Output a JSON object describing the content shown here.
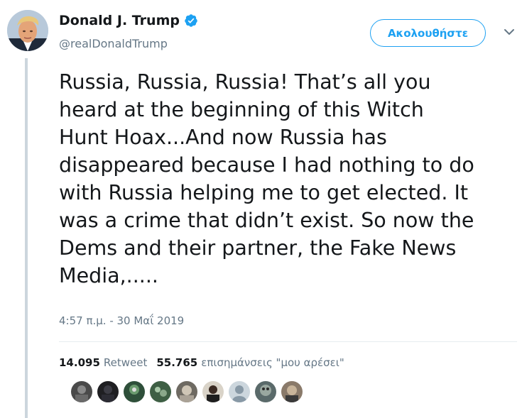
{
  "author": {
    "name": "Donald J. Trump",
    "handle": "@realDonaldTrump"
  },
  "follow_button": {
    "label": "Ακολουθήστε"
  },
  "tweet": {
    "text": "Russia, Russia, Russia! That’s all you\nheard at the beginning of this Witch\nHunt Hoax...And now Russia has\ndisappeared because I had nothing to do\nwith Russia helping me to get elected. It\nwas a crime that didn’t exist. So now the\nDems and their partner, the Fake News\nMedia,.....",
    "timestamp": "4:57 π.μ. - 30 Μαΐ 2019"
  },
  "stats": {
    "retweet_count": "14.095",
    "retweet_label": "Retweet",
    "like_count": "55.765",
    "like_label": "επισημάνσεις \"μου αρέσει\""
  },
  "colors": {
    "accent": "#1da1f2",
    "secondary_text": "#657786",
    "thread_line": "#ccd6dd"
  },
  "icons": [
    "verified-badge-icon",
    "chevron-down-icon"
  ]
}
